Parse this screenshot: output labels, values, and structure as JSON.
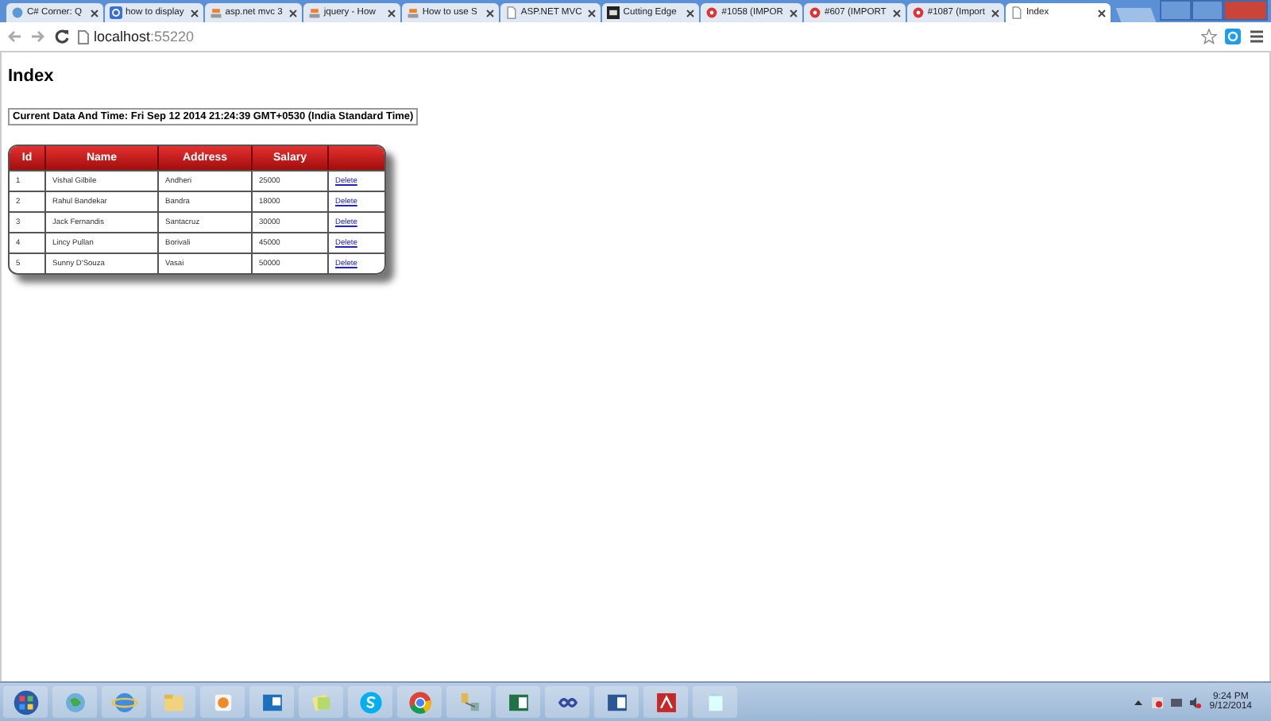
{
  "browser": {
    "tabs": [
      {
        "title": "C# Corner: Q",
        "kind": "site",
        "selected": false
      },
      {
        "title": "how to display",
        "kind": "search",
        "selected": false
      },
      {
        "title": "asp.net mvc 3",
        "kind": "stack",
        "selected": false
      },
      {
        "title": "jquery - How",
        "kind": "stack",
        "selected": false
      },
      {
        "title": "How to use S",
        "kind": "stack",
        "selected": false
      },
      {
        "title": "ASP.NET MVC",
        "kind": "page",
        "selected": false
      },
      {
        "title": "Cutting Edge",
        "kind": "magazine",
        "selected": false
      },
      {
        "title": "#1058 (IMPOR",
        "kind": "bug",
        "selected": false
      },
      {
        "title": "#607 (IMPORT",
        "kind": "bug",
        "selected": false
      },
      {
        "title": "#1087 (Import",
        "kind": "bug",
        "selected": false
      },
      {
        "title": "Index",
        "kind": "page",
        "selected": true
      }
    ],
    "address": {
      "host": "localhost",
      "port": ":55220"
    }
  },
  "page": {
    "heading": "Index",
    "datetime": "Current Data And Time: Fri Sep 12 2014 21:24:39 GMT+0530 (India Standard Time)",
    "table": {
      "columns": [
        "Id",
        "Name",
        "Address",
        "Salary"
      ],
      "rows": [
        {
          "id": "1",
          "name": "Vishal Gilbile",
          "address": "Andheri",
          "salary": "25000",
          "action": "Delete"
        },
        {
          "id": "2",
          "name": "Rahul Bandekar",
          "address": "Bandra",
          "salary": "18000",
          "action": "Delete"
        },
        {
          "id": "3",
          "name": "Jack Fernandis",
          "address": "Santacruz",
          "salary": "30000",
          "action": "Delete"
        },
        {
          "id": "4",
          "name": "Lincy Pullan",
          "address": "Borivali",
          "salary": "45000",
          "action": "Delete"
        },
        {
          "id": "5",
          "name": "Sunny D'Souza",
          "address": "Vasai",
          "salary": "50000",
          "action": "Delete"
        }
      ]
    }
  },
  "taskbar": {
    "time": "9:24 PM",
    "date": "9/12/2014"
  }
}
